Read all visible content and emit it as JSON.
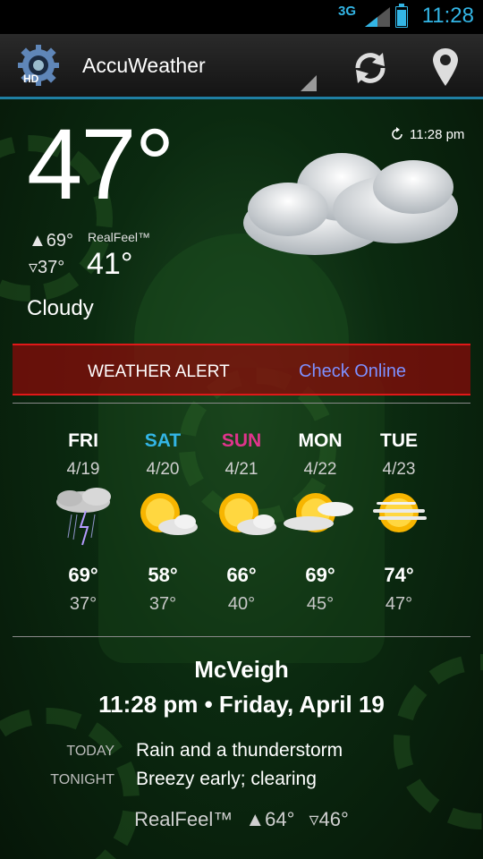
{
  "status_bar": {
    "network": "3G",
    "time": "11:28"
  },
  "app": {
    "title": "AccuWeather",
    "icon_label": "HD"
  },
  "current": {
    "temperature": "47°",
    "high": "▲69°",
    "low": "▿37°",
    "realfeel_label": "RealFeel™",
    "realfeel_value": "41°",
    "condition": "Cloudy",
    "updated_time": "11:28 pm"
  },
  "alert": {
    "title": "WEATHER ALERT",
    "link": "Check Online"
  },
  "forecast": [
    {
      "day": "FRI",
      "date": "4/19",
      "high": "69°",
      "low": "37°",
      "icon": "thunderstorm-icon",
      "color": "#ffffff"
    },
    {
      "day": "SAT",
      "date": "4/20",
      "high": "58°",
      "low": "37°",
      "icon": "partly-sunny-icon",
      "color": "#33b5e5"
    },
    {
      "day": "SUN",
      "date": "4/21",
      "high": "66°",
      "low": "40°",
      "icon": "partly-sunny-icon",
      "color": "#e0348c"
    },
    {
      "day": "MON",
      "date": "4/22",
      "high": "69°",
      "low": "45°",
      "icon": "partly-sunny-icon",
      "color": "#ffffff"
    },
    {
      "day": "TUE",
      "date": "4/23",
      "high": "74°",
      "low": "47°",
      "icon": "hazy-sun-icon",
      "color": "#ffffff"
    }
  ],
  "location": {
    "name": "McVeigh",
    "datetime": "11:28 pm • Friday, April 19"
  },
  "summary": {
    "today_label": "TODAY",
    "today_text": "Rain and a thunderstorm",
    "tonight_label": "TONIGHT",
    "tonight_text": "Breezy early; clearing",
    "realfeel_label": "RealFeel™",
    "realfeel_high": "▲64°",
    "realfeel_low": "▿46°"
  },
  "colors": {
    "accent": "#33b5e5",
    "alert_red": "#e01818",
    "link": "#7d90ff"
  }
}
